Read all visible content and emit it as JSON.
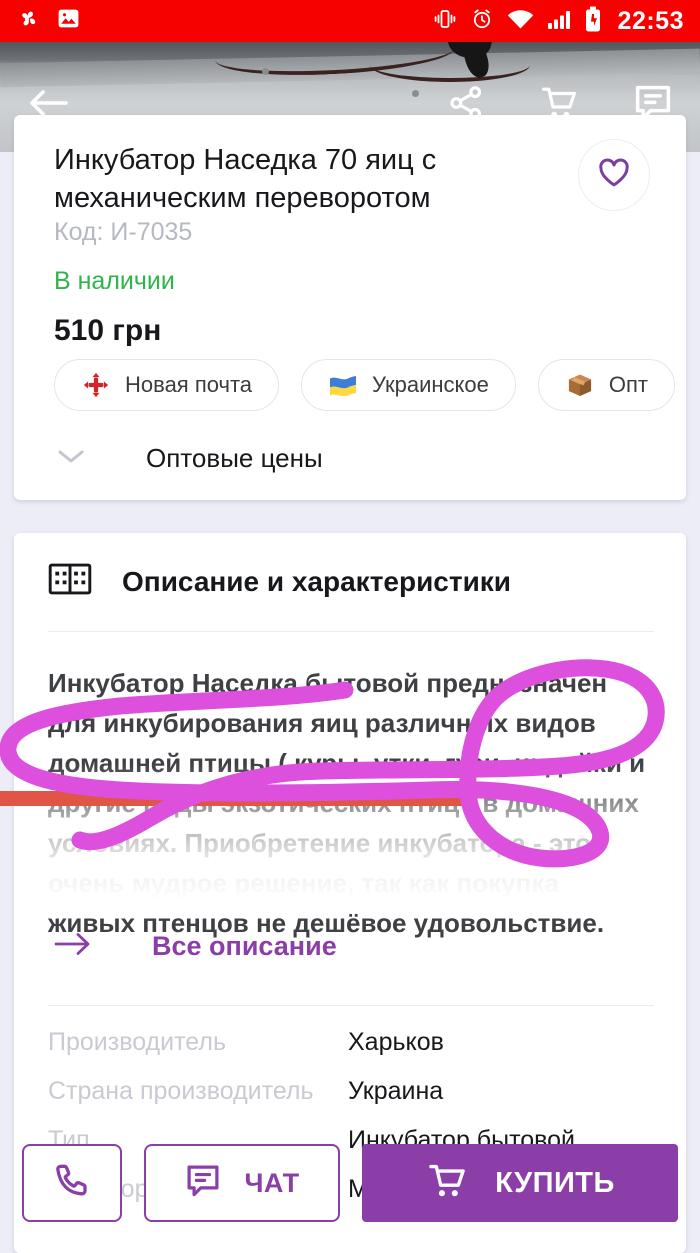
{
  "statusbar": {
    "time": "22:53",
    "bg": "#F60000",
    "left_icons": [
      "pinwheel-icon",
      "gallery-icon"
    ],
    "right_icons": [
      "vibrate-icon",
      "alarm-icon",
      "wifi-icon",
      "signal-icon",
      "battery-charging-icon"
    ]
  },
  "toolbar": {
    "back_icon": "back-arrow-icon",
    "share_icon": "share-icon",
    "cart_icon": "cart-icon",
    "chat_icon": "chat-icon"
  },
  "product": {
    "title": "Инкубатор Наседка 70 яиц с механическим переворотом",
    "code": "Код: И-7035",
    "availability": "В наличии",
    "availability_color": "#2EB44A",
    "price": "510 грн",
    "favorite_icon": "heart-icon",
    "chips": [
      {
        "label": "Новая почта",
        "icon": "nova-poshta-icon"
      },
      {
        "label": "Украинское",
        "icon": "ukraine-flag-icon"
      },
      {
        "label": "Опт",
        "icon": "box-icon"
      }
    ],
    "wholesale": {
      "label": "Оптовые цены",
      "icon": "chevron-down-icon"
    }
  },
  "description": {
    "header": "Описание и характеристики",
    "header_icon": "book-icon",
    "body_lines": [
      "Инкубатор Наседка бытовой предназначен",
      "для инкубирования яиц различных видов",
      "домашней птицы ( куры, утки, гуси, индейки и",
      "другие виды экзотических птиц ) в домашних",
      "условиях. Приобретение инкубатора - это",
      "очень мудрое решение, так как покупка",
      "живых птенцов не дешёвое удовольствие."
    ],
    "all_link": "Все описание",
    "all_link_icon": "arrow-right-icon",
    "link_color": "#8B3DA8"
  },
  "specs": [
    {
      "key": "Производитель",
      "value": "Харьков"
    },
    {
      "key": "Страна производитель",
      "value": "Украина"
    },
    {
      "key": "Тип",
      "value": "Инкубатор бытовой"
    },
    {
      "key": "Переворот яиц",
      "value": "Механический"
    }
  ],
  "actionbar": {
    "call_icon": "phone-icon",
    "chat_icon": "chat-bubble-icon",
    "chat_label": "ЧАТ",
    "buy_icon": "cart-icon",
    "buy_label": "КУПИТЬ",
    "accent": "#8B3DA8"
  },
  "annotations": {
    "circle_color": "#DD50DD",
    "line_color": "#E05545"
  }
}
